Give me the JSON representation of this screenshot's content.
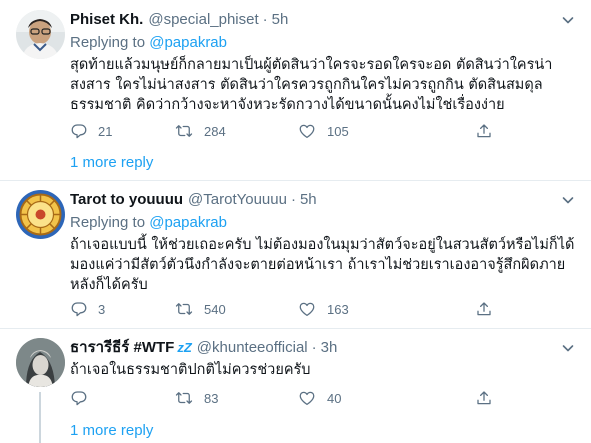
{
  "tweets": [
    {
      "name": "Phiset Kh.",
      "handle": "@special_phiset",
      "dot": "·",
      "time": "5h",
      "replying_prefix": "Replying to ",
      "replying_to": "@papakrab",
      "text": "สุดท้ายแล้วมนุษย์ก็กลายมาเป็นผู้ตัดสินว่าใครจะรอดใครจะอด ตัดสินว่าใครน่าสงสาร ใครไม่น่าสงสาร ตัดสินว่าใครควรถูกกินใครไม่ควรถูกกิน ตัดสินสมดุลธรรมชาติ คิดว่ากว้างจะหาจังหวะรัดกวางได้ขนาดนั้นคงไม่ใช่เรื่องง่าย",
      "replies": "21",
      "retweets": "284",
      "likes": "105",
      "more_replies": "1 more reply"
    },
    {
      "name": "Tarot to youuuu",
      "handle": "@TarotYouuuu",
      "dot": "·",
      "time": "5h",
      "replying_prefix": "Replying to ",
      "replying_to": "@papakrab",
      "text": "ถ้าเจอแบบนี้ ให้ช่วยเถอะครับ ไม่ต้องมองในมุมว่าสัตว์จะอยู่ในสวนสัตว์หรือไม่ก็ได้ มองแค่ว่ามีสัตว์ตัวนึงกำลังจะตายต่อหน้าเรา ถ้าเราไม่ช่วยเราเองอาจรู้สึกผิดภายหลังก็ได้ครับ",
      "replies": "3",
      "retweets": "540",
      "likes": "163"
    },
    {
      "name": "ธารารีธีร์ #WTF",
      "name_suffix": "zZ",
      "handle": "@khunteeofficial",
      "dot": "·",
      "time": "3h",
      "text": "ถ้าเจอในธรรมชาติปกติไม่ควรช่วยครับ",
      "replies": "",
      "retweets": "83",
      "likes": "40",
      "more_replies": "1 more reply"
    }
  ],
  "colors": {
    "accent": "#1da1f2",
    "secondary_text": "#5b7083",
    "divider": "#e6ecf0"
  },
  "icons": [
    "chevron-down-icon",
    "reply-icon",
    "retweet-icon",
    "like-icon",
    "share-icon"
  ]
}
